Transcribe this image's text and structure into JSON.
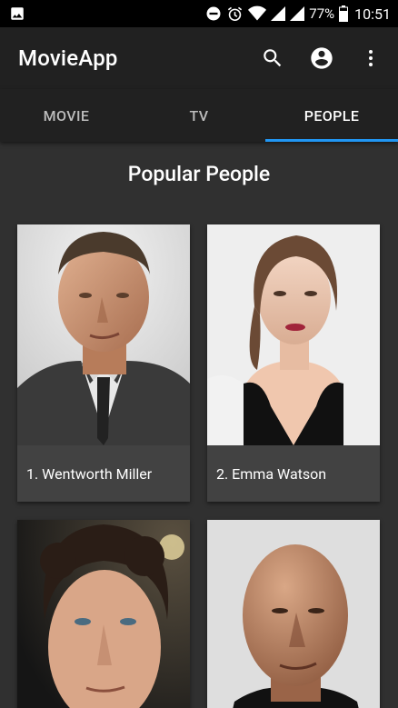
{
  "status_bar": {
    "battery_percent": "77%",
    "time": "10:51",
    "icons": [
      "image-icon",
      "dnd-icon",
      "alarm-icon",
      "wifi-icon",
      "signal-icon",
      "signal-icon",
      "battery-icon"
    ]
  },
  "app_bar": {
    "title": "MovieApp",
    "actions": [
      "search-icon",
      "account-icon",
      "more-vert-icon"
    ]
  },
  "tabs": [
    {
      "label": "MOVIE",
      "active": false
    },
    {
      "label": "TV",
      "active": false
    },
    {
      "label": "PEOPLE",
      "active": true
    }
  ],
  "accent_color": "#2196F3",
  "section": {
    "title": "Popular People"
  },
  "people": [
    {
      "label": "1. Wentworth Miller"
    },
    {
      "label": "2. Emma Watson"
    },
    {
      "label": ""
    },
    {
      "label": ""
    }
  ]
}
